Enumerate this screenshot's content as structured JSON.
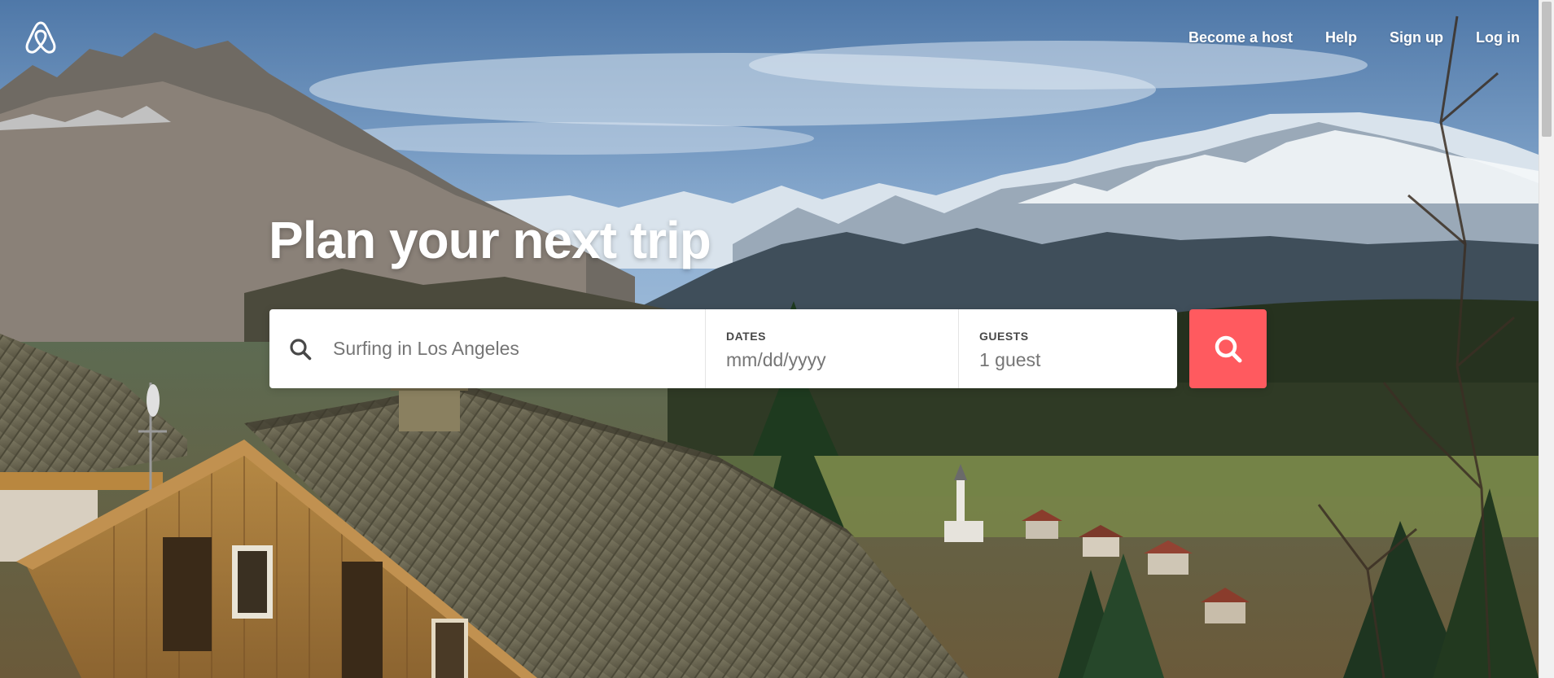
{
  "app": {
    "brand": "Airbnb",
    "accent_color": "#ff5a5f",
    "logo_icon": "airbnb-belo-icon"
  },
  "nav": {
    "items": [
      {
        "label": "Become a host"
      },
      {
        "label": "Help"
      },
      {
        "label": "Sign up"
      },
      {
        "label": "Log in"
      }
    ]
  },
  "hero": {
    "headline": "Plan your next trip",
    "background": "mountain-village-chalet-photo"
  },
  "search": {
    "where_placeholder": "Surfing in Los Angeles",
    "where_icon": "search-icon",
    "dates": {
      "label": "DATES",
      "placeholder": "mm/dd/yyyy"
    },
    "guests": {
      "label": "GUESTS",
      "value": "1 guest"
    },
    "submit_icon": "search-icon"
  }
}
